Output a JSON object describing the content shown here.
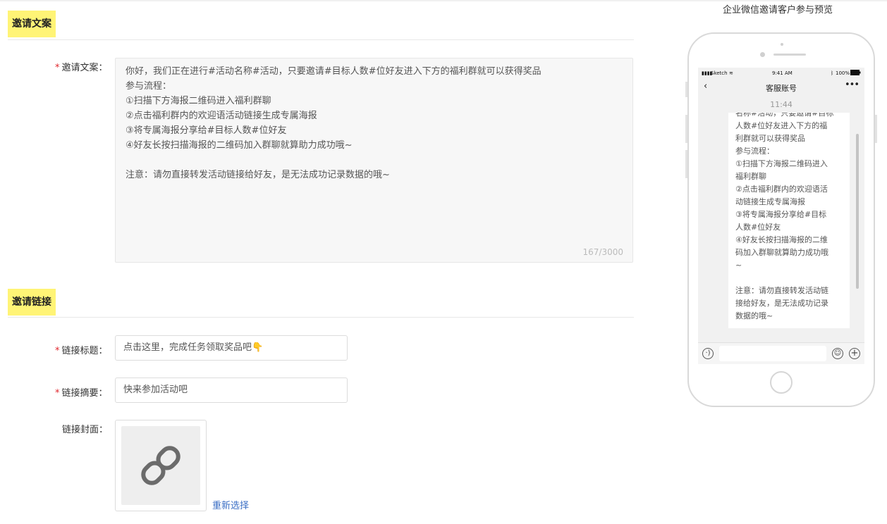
{
  "sections": {
    "invite_copy": "邀请文案",
    "invite_link": "邀请链接"
  },
  "form": {
    "required_mark": "*",
    "copy_label": "邀请文案：",
    "copy_lines": [
      "你好，我们正在进行#活动名称#活动，只要邀请#目标人数#位好友进入下方的福利群就可以获得奖品",
      "参与流程：",
      "①扫描下方海报二维码进入福利群聊",
      "②点击福利群内的欢迎语活动链接生成专属海报",
      "③将专属海报分享给#目标人数#位好友",
      "④好友长按扫描海报的二维码加入群聊就算助力成功哦~",
      "",
      "注意：请勿直接转发活动链接给好友，是无法成功记录数据的哦~"
    ],
    "copy_counter": "167/3000",
    "link_title_label": "链接标题：",
    "link_title_value": "点击这里，完成任务领取奖品吧👇",
    "link_summary_label": "链接摘要：",
    "link_summary_value": "快来参加活动吧",
    "link_cover_label": "链接封面：",
    "reselect_label": "重新选择",
    "cover_icon": "link-icon"
  },
  "preview": {
    "title": "企业微信邀请客户参与预览",
    "status": {
      "carrier": "Sketch",
      "time": "9:41 AM",
      "battery": "100%"
    },
    "nav_title": "客服账号",
    "chat_time": "11:44",
    "bubble_lines": [
      "名称#活动，只要邀请#目标",
      "人数#位好友进入下方的福",
      "利群就可以获得奖品",
      "参与流程：",
      "①扫描下方海报二维码进入",
      "福利群聊",
      "②点击福利群内的欢迎语活",
      "动链接生成专属海报",
      "③将专属海报分享给#目标",
      "人数#位好友",
      "④好友长按扫描海报的二维",
      "码加入群聊就算助力成功哦",
      "~",
      "",
      "注意：请勿直接转发活动链",
      "接给好友，是无法成功记录",
      "数据的哦~"
    ]
  },
  "colors": {
    "section_highlight": "#fff476",
    "required": "#e0262c",
    "link": "#3a6ec4"
  }
}
